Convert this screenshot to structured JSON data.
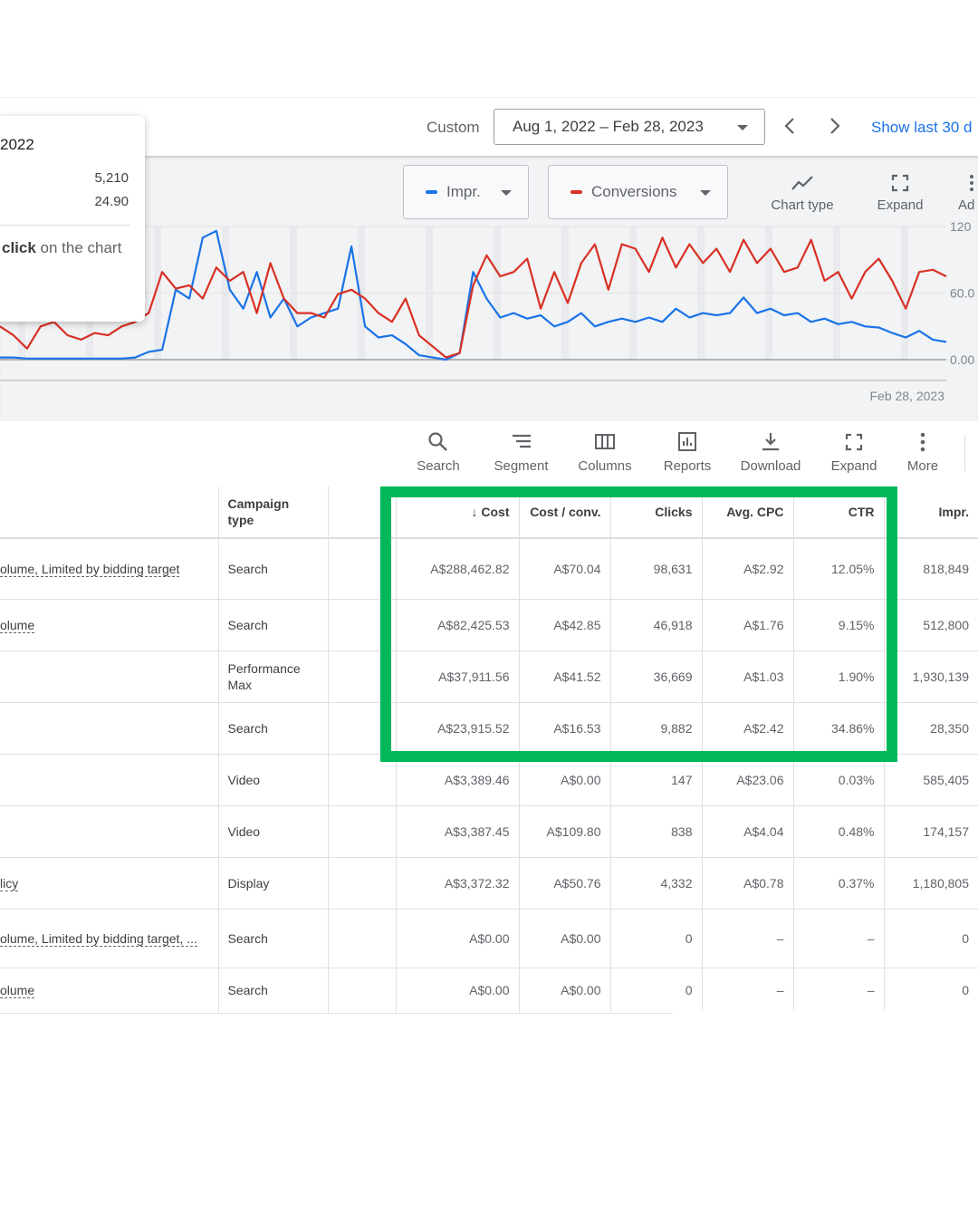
{
  "header": {
    "range_label": "Custom",
    "date_range": "Aug 1, 2022 – Feb 28, 2023",
    "show_last": "Show last 30 d"
  },
  "tooltip": {
    "date": "2022",
    "values": [
      "5,210",
      "24.90"
    ],
    "hint_bold": "click",
    "hint_rest": " on the chart"
  },
  "chart_controls": {
    "metric1": "Impr.",
    "metric2": "Conversions",
    "chart_type": "Chart type",
    "expand": "Expand",
    "ad": "Ad"
  },
  "colors": {
    "impr": "#1a73e8",
    "conversions": "#d93025",
    "highlight": "#00b859"
  },
  "chart_data": {
    "type": "line",
    "ylim": [
      0,
      120
    ],
    "y_ticks": [
      "120",
      "60.0",
      "0.00"
    ],
    "x_end_label": "Feb 28, 2023",
    "series": [
      {
        "name": "Impr.",
        "values": [
          2,
          2,
          1,
          1,
          1,
          1,
          1,
          1,
          1,
          1,
          2,
          7,
          9,
          63,
          55,
          110,
          116,
          63,
          46,
          79,
          38,
          55,
          30,
          38,
          42,
          46,
          102,
          30,
          20,
          22,
          14,
          4,
          2,
          0,
          6,
          79,
          55,
          38,
          42,
          37,
          40,
          30,
          34,
          42,
          30,
          34,
          37,
          34,
          38,
          34,
          46,
          38,
          42,
          40,
          42,
          56,
          42,
          46,
          40,
          42,
          34,
          37,
          32,
          34,
          30,
          29,
          24,
          20,
          26,
          18,
          16
        ]
      },
      {
        "name": "Conversions",
        "values": [
          30,
          22,
          10,
          30,
          34,
          22,
          18,
          24,
          22,
          30,
          34,
          42,
          79,
          64,
          67,
          55,
          83,
          71,
          79,
          42,
          87,
          55,
          42,
          42,
          38,
          59,
          63,
          55,
          42,
          34,
          55,
          22,
          12,
          2,
          6,
          67,
          94,
          75,
          79,
          91,
          46,
          79,
          51,
          87,
          104,
          63,
          104,
          100,
          79,
          110,
          83,
          104,
          87,
          100,
          79,
          108,
          87,
          100,
          79,
          83,
          108,
          71,
          79,
          55,
          79,
          91,
          71,
          46,
          79,
          81,
          75
        ]
      }
    ]
  },
  "toolbar": [
    "Search",
    "Segment",
    "Columns",
    "Reports",
    "Download",
    "Expand",
    "More"
  ],
  "table": {
    "headers": {
      "campaign_type": "Campaign type",
      "cost": "Cost",
      "cost_conv": "Cost / conv.",
      "clicks": "Clicks",
      "avg_cpc": "Avg. CPC",
      "ctr": "CTR",
      "impr": "Impr."
    },
    "rows": [
      {
        "status": "olume, Limited by bidding target",
        "type": "Search",
        "cost": "A$288,462.82",
        "cost_conv": "A$70.04",
        "clicks": "98,631",
        "avg_cpc": "A$2.92",
        "ctr": "12.05%",
        "impr": "818,849"
      },
      {
        "status": "olume",
        "type": "Search",
        "cost": "A$82,425.53",
        "cost_conv": "A$42.85",
        "clicks": "46,918",
        "avg_cpc": "A$1.76",
        "ctr": "9.15%",
        "impr": "512,800"
      },
      {
        "status": "",
        "type": "Performance Max",
        "cost": "A$37,911.56",
        "cost_conv": "A$41.52",
        "clicks": "36,669",
        "avg_cpc": "A$1.03",
        "ctr": "1.90%",
        "impr": "1,930,139"
      },
      {
        "status": "",
        "type": "Search",
        "cost": "A$23,915.52",
        "cost_conv": "A$16.53",
        "clicks": "9,882",
        "avg_cpc": "A$2.42",
        "ctr": "34.86%",
        "impr": "28,350"
      },
      {
        "status": "",
        "type": "Video",
        "cost": "A$3,389.46",
        "cost_conv": "A$0.00",
        "clicks": "147",
        "avg_cpc": "A$23.06",
        "ctr": "0.03%",
        "impr": "585,405"
      },
      {
        "status": "",
        "type": "Video",
        "cost": "A$3,387.45",
        "cost_conv": "A$109.80",
        "clicks": "838",
        "avg_cpc": "A$4.04",
        "ctr": "0.48%",
        "impr": "174,157"
      },
      {
        "status": "licy",
        "type": "Display",
        "cost": "A$3,372.32",
        "cost_conv": "A$50.76",
        "clicks": "4,332",
        "avg_cpc": "A$0.78",
        "ctr": "0.37%",
        "impr": "1,180,805"
      },
      {
        "status": "olume, Limited by bidding target, ...",
        "type": "Search",
        "cost": "A$0.00",
        "cost_conv": "A$0.00",
        "clicks": "0",
        "avg_cpc": "–",
        "ctr": "–",
        "impr": "0"
      },
      {
        "status": "olume",
        "type": "Search",
        "cost": "A$0.00",
        "cost_conv": "A$0.00",
        "clicks": "0",
        "avg_cpc": "–",
        "ctr": "–",
        "impr": "0"
      }
    ]
  }
}
